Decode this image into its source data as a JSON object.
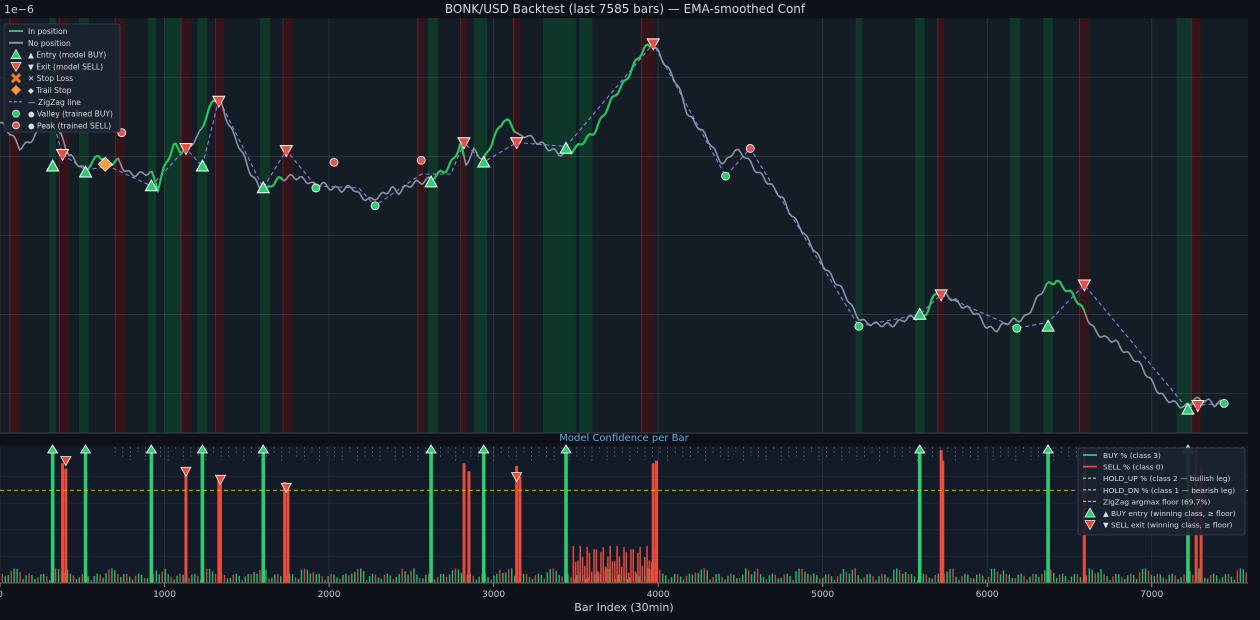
{
  "figure": {
    "title": "BONK/USD Backtest (last 7585 bars) — EMA-smoothed Conf",
    "scale_note": "1e−6"
  },
  "colors": {
    "background": "#0e1117",
    "in_position": "#22c55e",
    "no_position": "#8b93a7",
    "zigzag": "#9b8cff",
    "buy": "#2ecc71",
    "sell": "#e74c3c",
    "stop_loss": "#f47c20",
    "trail_stop": "#f39c45",
    "valley": "#2ecc71",
    "peak": "#e05555",
    "floor_line": "#e6c229",
    "panel_title": "#5dade2",
    "shade_green": "#0d3b2a",
    "shade_red": "#3a1218"
  },
  "chart_data": [
    {
      "type": "line",
      "panel": "price",
      "x_range": [
        0,
        7585
      ],
      "y_range": [
        0,
        1
      ],
      "y_scale_note": "1e−6",
      "grid": true,
      "legend_position": "top-left",
      "legend": [
        {
          "key": "in_position",
          "label": "In position"
        },
        {
          "key": "no_position",
          "label": "No position"
        },
        {
          "key": "entry",
          "label": "▲ Entry  (model BUY)"
        },
        {
          "key": "exit",
          "label": "▼ Exit   (model SELL)"
        },
        {
          "key": "stop_loss",
          "label": "✕ Stop Loss"
        },
        {
          "key": "trail_stop",
          "label": "◆ Trail Stop"
        },
        {
          "key": "zigzag",
          "label": "— ZigZag line"
        },
        {
          "key": "valley",
          "label": "● Valley (trained BUY)"
        },
        {
          "key": "peak",
          "label": "● Peak  (trained SELL)"
        }
      ],
      "price_path": [
        [
          0,
          0.57
        ],
        [
          60,
          0.51
        ],
        [
          120,
          0.45
        ],
        [
          180,
          0.48
        ],
        [
          240,
          0.52
        ],
        [
          320,
          0.58
        ],
        [
          380,
          0.5
        ],
        [
          420,
          0.4
        ],
        [
          480,
          0.35
        ],
        [
          520,
          0.33
        ],
        [
          540,
          0.36
        ],
        [
          600,
          0.41
        ],
        [
          660,
          0.35
        ],
        [
          720,
          0.38
        ],
        [
          760,
          0.34
        ],
        [
          800,
          0.31
        ],
        [
          860,
          0.3
        ],
        [
          920,
          0.32
        ],
        [
          960,
          0.25
        ],
        [
          1000,
          0.35
        ],
        [
          1060,
          0.45
        ],
        [
          1100,
          0.42
        ],
        [
          1160,
          0.47
        ],
        [
          1200,
          0.5
        ],
        [
          1260,
          0.6
        ],
        [
          1300,
          0.69
        ],
        [
          1340,
          0.68
        ],
        [
          1400,
          0.55
        ],
        [
          1460,
          0.43
        ],
        [
          1520,
          0.32
        ],
        [
          1580,
          0.25
        ],
        [
          1620,
          0.23
        ],
        [
          1700,
          0.28
        ],
        [
          1780,
          0.31
        ],
        [
          1840,
          0.28
        ],
        [
          1900,
          0.25
        ],
        [
          1960,
          0.27
        ],
        [
          2020,
          0.24
        ],
        [
          2080,
          0.22
        ],
        [
          2140,
          0.25
        ],
        [
          2200,
          0.2
        ],
        [
          2260,
          0.17
        ],
        [
          2320,
          0.2
        ],
        [
          2380,
          0.25
        ],
        [
          2420,
          0.22
        ],
        [
          2480,
          0.24
        ],
        [
          2540,
          0.27
        ],
        [
          2600,
          0.29
        ],
        [
          2660,
          0.3
        ],
        [
          2720,
          0.33
        ],
        [
          2760,
          0.4
        ],
        [
          2800,
          0.47
        ],
        [
          2830,
          0.36
        ],
        [
          2880,
          0.42
        ],
        [
          2940,
          0.38
        ],
        [
          3000,
          0.5
        ],
        [
          3060,
          0.58
        ],
        [
          3100,
          0.56
        ],
        [
          3160,
          0.5
        ],
        [
          3200,
          0.52
        ],
        [
          3260,
          0.47
        ],
        [
          3320,
          0.44
        ],
        [
          3380,
          0.43
        ],
        [
          3440,
          0.41
        ],
        [
          3500,
          0.43
        ],
        [
          3560,
          0.49
        ],
        [
          3620,
          0.54
        ],
        [
          3680,
          0.62
        ],
        [
          3740,
          0.71
        ],
        [
          3800,
          0.79
        ],
        [
          3860,
          0.87
        ],
        [
          3920,
          0.94
        ],
        [
          3960,
          0.97
        ],
        [
          4000,
          0.94
        ],
        [
          4060,
          0.84
        ],
        [
          4120,
          0.75
        ],
        [
          4180,
          0.62
        ],
        [
          4240,
          0.56
        ],
        [
          4300,
          0.48
        ],
        [
          4360,
          0.4
        ],
        [
          4400,
          0.37
        ],
        [
          4460,
          0.43
        ],
        [
          4520,
          0.4
        ],
        [
          4580,
          0.35
        ],
        [
          4640,
          0.3
        ],
        [
          4700,
          0.23
        ],
        [
          4760,
          0.18
        ],
        [
          4820,
          0.1
        ],
        [
          4860,
          0.05
        ],
        [
          4900,
          -0.02
        ],
        [
          4960,
          -0.09
        ],
        [
          5020,
          -0.16
        ],
        [
          5080,
          -0.24
        ],
        [
          5140,
          -0.31
        ],
        [
          5200,
          -0.39
        ],
        [
          5260,
          -0.44
        ],
        [
          5320,
          -0.46
        ],
        [
          5380,
          -0.45
        ],
        [
          5440,
          -0.44
        ],
        [
          5500,
          -0.43
        ],
        [
          5560,
          -0.42
        ],
        [
          5620,
          -0.4
        ],
        [
          5660,
          -0.33
        ],
        [
          5700,
          -0.29
        ],
        [
          5760,
          -0.31
        ],
        [
          5820,
          -0.33
        ],
        [
          5880,
          -0.37
        ],
        [
          5940,
          -0.41
        ],
        [
          6000,
          -0.46
        ],
        [
          6060,
          -0.47
        ],
        [
          6120,
          -0.45
        ],
        [
          6180,
          -0.43
        ],
        [
          6240,
          -0.4
        ],
        [
          6300,
          -0.33
        ],
        [
          6360,
          -0.26
        ],
        [
          6420,
          -0.22
        ],
        [
          6480,
          -0.27
        ],
        [
          6540,
          -0.33
        ],
        [
          6600,
          -0.4
        ],
        [
          6660,
          -0.48
        ],
        [
          6720,
          -0.53
        ],
        [
          6780,
          -0.54
        ],
        [
          6840,
          -0.58
        ],
        [
          6900,
          -0.63
        ],
        [
          6960,
          -0.7
        ],
        [
          7020,
          -0.76
        ],
        [
          7080,
          -0.82
        ],
        [
          7140,
          -0.86
        ],
        [
          7200,
          -0.87
        ],
        [
          7260,
          -0.82
        ],
        [
          7320,
          -0.84
        ],
        [
          7380,
          -0.86
        ],
        [
          7440,
          -0.83
        ]
      ],
      "in_position_ranges": [
        [
          330,
          380
        ],
        [
          520,
          720
        ],
        [
          920,
          1130
        ],
        [
          1230,
          1330
        ],
        [
          1620,
          1720
        ],
        [
          2640,
          2820
        ],
        [
          2940,
          3140
        ],
        [
          3440,
          3970
        ],
        [
          5580,
          5720
        ],
        [
          6370,
          6590
        ],
        [
          7200,
          7260
        ]
      ],
      "zigzag": [
        [
          320,
          0.58
        ],
        [
          380,
          0.41
        ],
        [
          520,
          0.33
        ],
        [
          660,
          0.35
        ],
        [
          920,
          0.25
        ],
        [
          1130,
          0.44
        ],
        [
          1230,
          0.35
        ],
        [
          1330,
          0.69
        ],
        [
          1600,
          0.24
        ],
        [
          1740,
          0.43
        ],
        [
          1920,
          0.25
        ],
        [
          2180,
          0.24
        ],
        [
          2280,
          0.15
        ],
        [
          2560,
          0.31
        ],
        [
          2740,
          0.31
        ],
        [
          2820,
          0.47
        ],
        [
          2940,
          0.37
        ],
        [
          3140,
          0.47
        ],
        [
          3440,
          0.45
        ],
        [
          3970,
          0.97
        ],
        [
          4410,
          0.3
        ],
        [
          4560,
          0.44
        ],
        [
          5220,
          -0.46
        ],
        [
          5590,
          -0.4
        ],
        [
          5720,
          -0.3
        ],
        [
          6180,
          -0.47
        ],
        [
          6370,
          -0.44
        ],
        [
          6590,
          -0.25
        ],
        [
          7220,
          -0.88
        ],
        [
          7260,
          -0.86
        ],
        [
          7440,
          -0.85
        ]
      ],
      "entries": [
        [
          320,
          0.35
        ],
        [
          520,
          0.32
        ],
        [
          920,
          0.25
        ],
        [
          1230,
          0.35
        ],
        [
          1600,
          0.24
        ],
        [
          2620,
          0.27
        ],
        [
          2940,
          0.37
        ],
        [
          3440,
          0.44
        ],
        [
          5590,
          -0.4
        ],
        [
          6370,
          -0.46
        ],
        [
          7220,
          -0.88
        ]
      ],
      "exits": [
        [
          380,
          0.41
        ],
        [
          1130,
          0.44
        ],
        [
          1330,
          0.68
        ],
        [
          1740,
          0.43
        ],
        [
          2820,
          0.47
        ],
        [
          3140,
          0.47
        ],
        [
          3970,
          0.97
        ],
        [
          5720,
          -0.3
        ],
        [
          6590,
          -0.25
        ],
        [
          7280,
          -0.86
        ]
      ],
      "stop_losses": [
        [
          640,
          0.36
        ]
      ],
      "trail_stops": [
        [
          640,
          0.36
        ]
      ],
      "valleys": [
        [
          1920,
          0.24
        ],
        [
          2280,
          0.15
        ],
        [
          4410,
          0.3
        ],
        [
          5220,
          -0.46
        ],
        [
          6180,
          -0.47
        ],
        [
          7440,
          -0.85
        ]
      ],
      "peaks": [
        [
          740,
          0.52
        ],
        [
          2030,
          0.37
        ],
        [
          2560,
          0.38
        ],
        [
          4560,
          0.44
        ]
      ],
      "shading_green": [
        [
          300,
          340
        ],
        [
          480,
          540
        ],
        [
          900,
          950
        ],
        [
          1000,
          1100
        ],
        [
          1200,
          1260
        ],
        [
          1580,
          1640
        ],
        [
          2600,
          2660
        ],
        [
          2880,
          2960
        ],
        [
          3300,
          3500
        ],
        [
          3520,
          3600
        ],
        [
          5200,
          5240
        ],
        [
          5560,
          5620
        ],
        [
          6140,
          6200
        ],
        [
          6340,
          6400
        ],
        [
          7150,
          7260
        ]
      ],
      "shading_red": [
        [
          60,
          120
        ],
        [
          360,
          420
        ],
        [
          700,
          760
        ],
        [
          1100,
          1160
        ],
        [
          1310,
          1360
        ],
        [
          1720,
          1780
        ],
        [
          2540,
          2580
        ],
        [
          2800,
          2840
        ],
        [
          3120,
          3160
        ],
        [
          3900,
          3980
        ],
        [
          5700,
          5740
        ],
        [
          6560,
          6620
        ],
        [
          7240,
          7300
        ]
      ]
    },
    {
      "type": "bar",
      "panel": "confidence",
      "title": "Model Confidence per Bar",
      "xlabel": "Bar Index (30min)",
      "x_range": [
        0,
        7585
      ],
      "y_range": [
        0,
        100
      ],
      "x_ticks": [
        0,
        1000,
        2000,
        3000,
        4000,
        5000,
        6000,
        7000
      ],
      "floor_pct": 69.7,
      "legend_position": "top-right",
      "legend": [
        {
          "key": "buy",
          "label": "BUY %  (class 3)"
        },
        {
          "key": "sell",
          "label": "SELL %  (class 0)"
        },
        {
          "key": "hold_up",
          "label": "HOLD_UP % (class 2 — bullish leg)"
        },
        {
          "key": "hold_dn",
          "label": "HOLD_DN % (class 1 — bearish leg)"
        },
        {
          "key": "floor",
          "label": "ZigZag argmax floor (69.7%)"
        },
        {
          "key": "buy_entry",
          "label": "▲ BUY entry (winning class, ≥ floor)"
        },
        {
          "key": "sell_exit",
          "label": "▼ SELL exit (winning class, ≥ floor)"
        }
      ],
      "buy_spikes": [
        [
          320,
          100
        ],
        [
          520,
          100
        ],
        [
          920,
          100
        ],
        [
          1230,
          100
        ],
        [
          1600,
          100
        ],
        [
          2620,
          100
        ],
        [
          2940,
          100
        ],
        [
          3440,
          100
        ],
        [
          5590,
          100
        ],
        [
          6370,
          100
        ],
        [
          7220,
          100
        ]
      ],
      "sell_spikes": [
        [
          380,
          90
        ],
        [
          400,
          86
        ],
        [
          1130,
          84
        ],
        [
          1330,
          80
        ],
        [
          1340,
          74
        ],
        [
          1730,
          76
        ],
        [
          1750,
          72
        ],
        [
          2820,
          90
        ],
        [
          2850,
          84
        ],
        [
          3140,
          88
        ],
        [
          3160,
          80
        ],
        [
          3970,
          90
        ],
        [
          3990,
          92
        ],
        [
          5720,
          100
        ],
        [
          5730,
          92
        ],
        [
          6590,
          100
        ],
        [
          7270,
          100
        ],
        [
          7300,
          86
        ]
      ],
      "buy_markers": [
        320,
        520,
        920,
        1230,
        1600,
        2620,
        2940,
        3440,
        5590,
        6370,
        7220
      ],
      "sell_markers": [
        [
          400,
          92
        ],
        [
          1130,
          84
        ],
        [
          1340,
          78
        ],
        [
          1740,
          72
        ],
        [
          3140,
          80
        ]
      ]
    }
  ]
}
